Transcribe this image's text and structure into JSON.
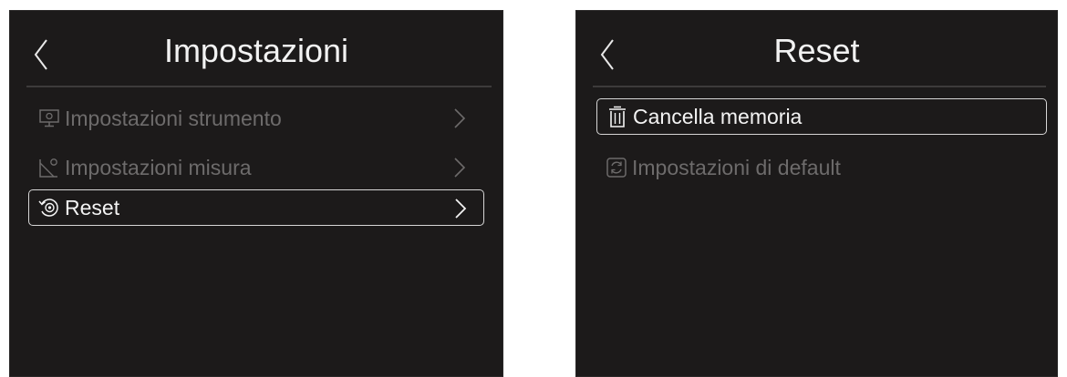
{
  "screens": [
    {
      "title": "Impostazioni",
      "items": [
        {
          "label": "Impostazioni strumento",
          "icon": "monitor-settings-icon",
          "selected": false
        },
        {
          "label": "Impostazioni misura",
          "icon": "measure-settings-icon",
          "selected": false
        },
        {
          "label": "Reset",
          "icon": "reset-gear-icon",
          "selected": true
        }
      ]
    },
    {
      "title": "Reset",
      "items": [
        {
          "label": "Cancella memoria",
          "icon": "trash-icon",
          "selected": true
        },
        {
          "label": "Impostazioni di default",
          "icon": "refresh-icon",
          "selected": false
        }
      ]
    }
  ],
  "colors": {
    "background": "#1c1a1a",
    "text_active": "#f3f3f3",
    "text_dim": "#6d6b6b",
    "selection_border": "#d6d6d6"
  }
}
